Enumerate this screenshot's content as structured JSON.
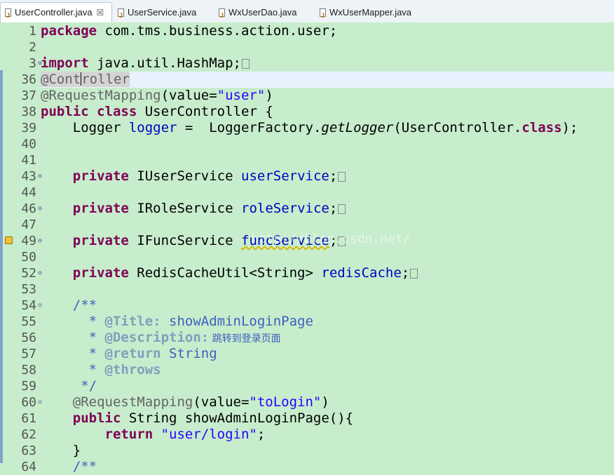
{
  "tabs": [
    {
      "label": "UserController.java",
      "active": true,
      "closable": true
    },
    {
      "label": "UserService.java",
      "active": false
    },
    {
      "label": "WxUserDao.java",
      "active": false
    },
    {
      "label": "WxUserMapper.java",
      "active": false
    }
  ],
  "watermark": "http://blog.csdn.net/",
  "code": {
    "l1": {
      "num": "1",
      "kw": "package",
      "rest": " com.tms.business.action.user;"
    },
    "l2": {
      "num": "2"
    },
    "l3": {
      "num": "3",
      "kw": "import",
      "rest": " java.util.HashMap;"
    },
    "l36": {
      "num": "36",
      "ann_a": "@Cont",
      "ann_b": "roller"
    },
    "l37": {
      "num": "37",
      "ann": "@RequestMapping",
      "a": "(value=",
      "str": "\"user\"",
      "b": ")"
    },
    "l38": {
      "num": "38",
      "kw1": "public",
      "kw2": "class",
      "rest": " UserController {"
    },
    "l39": {
      "num": "39",
      "type": "    Logger ",
      "field": "logger",
      "mid": " =  LoggerFactory.",
      "method": "getLogger",
      "arg": "(UserController.",
      "kw": "class",
      "end": ");"
    },
    "l40": {
      "num": "40"
    },
    "l41": {
      "num": "41"
    },
    "l43": {
      "num": "43",
      "kw": "private",
      "type": " IUserService ",
      "field": "userService",
      "end": ";"
    },
    "l44": {
      "num": "44"
    },
    "l46": {
      "num": "46",
      "kw": "private",
      "type": " IRoleService ",
      "field": "roleService",
      "end": ";"
    },
    "l47": {
      "num": "47"
    },
    "l49": {
      "num": "49",
      "kw": "private",
      "type": " IFuncService ",
      "field": "funcService",
      "end": ";"
    },
    "l50": {
      "num": "50"
    },
    "l52": {
      "num": "52",
      "kw": "private",
      "type": " RedisCacheUtil<String> ",
      "field": "redisCache",
      "end": ";"
    },
    "l53": {
      "num": "53"
    },
    "l54": {
      "num": "54",
      "cmt": "    /**"
    },
    "l55": {
      "num": "55",
      "star": "      * ",
      "tag": "@Title:",
      "text": " showAdminLoginPage"
    },
    "l56": {
      "num": "56",
      "star": "      * ",
      "tag": "@Description:",
      "text": " 跳转到登录页面"
    },
    "l57": {
      "num": "57",
      "star": "      * ",
      "tag": "@return",
      "text": " String"
    },
    "l58": {
      "num": "58",
      "star": "      * ",
      "tag": "@throws",
      "text": ""
    },
    "l59": {
      "num": "59",
      "cmt": "     */"
    },
    "l60": {
      "num": "60",
      "ann": "    @RequestMapping",
      "a": "(value=",
      "str": "\"toLogin\"",
      "b": ")"
    },
    "l61": {
      "num": "61",
      "kw": "    public",
      "rest": " String showAdminLoginPage(){"
    },
    "l62": {
      "num": "62",
      "kw": "        return",
      "str": " \"user/login\"",
      "end": ";"
    },
    "l63": {
      "num": "63",
      "text": "    }"
    },
    "l64": {
      "num": "64",
      "cmt": "    /**"
    }
  },
  "colors": {
    "background": "#c7edcc",
    "keyword": "#7f0055",
    "string": "#2a00ff",
    "field": "#0000c0",
    "comment": "#3f5fbf"
  }
}
